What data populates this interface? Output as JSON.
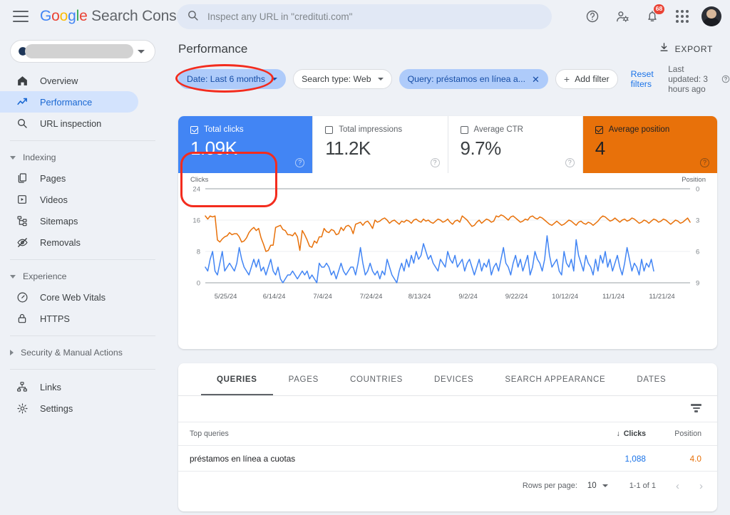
{
  "topbar": {
    "menu_icon": "hamburger-menu-icon",
    "brand": {
      "g": "G",
      "o1": "o",
      "o2": "o",
      "gg": "g",
      "l": "l",
      "e": "e",
      "suffix": " Search Console"
    },
    "search": {
      "placeholder": "Inspect any URL in \"credituti.com\"",
      "value": "",
      "icon": "search-icon"
    },
    "help_icon": "help-circle-icon",
    "account_icon": "account-settings-icon",
    "notifications_icon": "notifications-bell-icon",
    "notifications_count": "68",
    "apps_icon": "apps-grid-icon",
    "avatar": "user-avatar"
  },
  "sidebar": {
    "property_selector": {
      "label": "",
      "redacted": true
    },
    "items": [
      {
        "label": "Overview",
        "icon": "home-icon",
        "active": false
      },
      {
        "label": "Performance",
        "icon": "trending-up-icon",
        "active": true
      },
      {
        "label": "URL inspection",
        "icon": "search-icon",
        "active": false
      }
    ],
    "groups": [
      {
        "label": "Indexing",
        "expanded": true,
        "items": [
          {
            "label": "Pages",
            "icon": "pages-icon"
          },
          {
            "label": "Videos",
            "icon": "video-icon"
          },
          {
            "label": "Sitemaps",
            "icon": "sitemap-icon"
          },
          {
            "label": "Removals",
            "icon": "eye-off-icon"
          }
        ]
      },
      {
        "label": "Experience",
        "expanded": true,
        "items": [
          {
            "label": "Core Web Vitals",
            "icon": "speedometer-icon"
          },
          {
            "label": "HTTPS",
            "icon": "lock-icon"
          }
        ]
      },
      {
        "label": "Security & Manual Actions",
        "expanded": false,
        "items": []
      }
    ],
    "bottom_items": [
      {
        "label": "Links",
        "icon": "links-hierarchy-icon"
      },
      {
        "label": "Settings",
        "icon": "gear-icon"
      }
    ]
  },
  "page": {
    "title": "Performance",
    "export_label": "EXPORT",
    "export_icon": "download-icon"
  },
  "filters": {
    "chips": [
      {
        "name": "date",
        "label": "Date: Last 6 months",
        "selected": true,
        "control": "dropdown",
        "highlighted": true
      },
      {
        "name": "search-type",
        "label": "Search type: Web",
        "selected": false,
        "control": "dropdown",
        "highlighted": false
      },
      {
        "name": "query",
        "label": "Query: préstamos en línea a...",
        "selected": true,
        "control": "close",
        "highlighted": false
      }
    ],
    "add_filter_label": "Add filter",
    "reset_label": "Reset filters",
    "last_updated": "Last updated: 3 hours ago",
    "help_icon": "help-circle-icon"
  },
  "metrics": [
    {
      "name": "total-clicks",
      "label": "Total clicks",
      "value": "1.09K",
      "checked": true,
      "state": "selected-blue",
      "highlighted": true
    },
    {
      "name": "total-impressions",
      "label": "Total impressions",
      "value": "11.2K",
      "checked": false,
      "state": "off",
      "highlighted": false
    },
    {
      "name": "average-ctr",
      "label": "Average CTR",
      "value": "9.7%",
      "checked": false,
      "state": "off",
      "highlighted": false
    },
    {
      "name": "average-position",
      "label": "Average position",
      "value": "4",
      "checked": true,
      "state": "selected-orange",
      "highlighted": false
    }
  ],
  "chart_data": {
    "type": "line",
    "title": "",
    "left_axis": {
      "label": "Clicks",
      "ticks": [
        "0",
        "8",
        "16",
        "24"
      ],
      "range": [
        0,
        24
      ],
      "color": "#4285f4"
    },
    "right_axis": {
      "label": "Position",
      "ticks": [
        "0",
        "3",
        "6",
        "9"
      ],
      "range": [
        0,
        9
      ],
      "inverted": true,
      "color": "#e8710a"
    },
    "xlabel": "",
    "x_ticks": [
      "5/25/24",
      "6/14/24",
      "7/4/24",
      "7/24/24",
      "8/13/24",
      "9/2/24",
      "9/22/24",
      "10/12/24",
      "11/1/24",
      "11/21/24"
    ],
    "grid": true,
    "legend_position": "none",
    "series": [
      {
        "name": "Clicks",
        "color": "#4285f4",
        "axis": "left",
        "values": [
          4,
          3,
          6,
          8,
          3,
          2,
          5,
          8,
          3,
          4,
          5,
          4,
          3,
          5,
          9,
          6,
          4,
          3,
          2,
          4,
          6,
          4,
          6,
          3,
          4,
          2,
          4,
          6,
          3,
          2,
          4,
          1,
          0,
          1,
          2,
          2,
          3,
          2,
          1,
          2,
          3,
          2,
          3,
          1,
          2,
          1,
          0,
          5,
          4,
          4,
          5,
          4,
          2,
          3,
          1,
          3,
          5,
          3,
          2,
          3,
          4,
          4,
          2,
          5,
          9,
          5,
          2,
          3,
          5,
          3,
          2,
          3,
          1,
          3,
          2,
          6,
          4,
          2,
          1,
          0,
          3,
          5,
          3,
          6,
          4,
          7,
          5,
          8,
          6,
          7,
          10,
          8,
          6,
          7,
          5,
          4,
          3,
          6,
          5,
          4,
          8,
          6,
          5,
          7,
          4,
          5,
          6,
          3,
          5,
          6,
          4,
          2,
          4,
          6,
          3,
          5,
          4,
          6,
          2,
          4,
          5,
          3,
          6,
          9,
          5,
          4,
          2,
          5,
          7,
          4,
          6,
          3,
          5,
          7,
          2,
          4,
          8,
          6,
          5,
          3,
          6,
          12,
          7,
          4,
          5,
          6,
          3,
          2,
          8,
          5,
          4,
          6,
          3,
          11,
          7,
          5,
          3,
          7,
          5,
          4,
          2,
          6,
          3,
          7,
          5,
          8,
          4,
          6,
          3,
          5,
          7,
          4,
          2,
          5,
          9,
          6,
          3,
          5,
          4,
          2,
          6,
          3,
          5,
          4,
          6,
          3
        ]
      },
      {
        "name": "Position",
        "color": "#e8710a",
        "axis": "right",
        "values": [
          2.6,
          2.9,
          2.6,
          2.7,
          2.6,
          4.9,
          5.1,
          4.8,
          4.6,
          4.5,
          4.2,
          4.4,
          4.3,
          4.3,
          4.6,
          5.1,
          5.0,
          4.7,
          4.2,
          3.9,
          3.7,
          4.0,
          3.8,
          4.7,
          5.3,
          6.0,
          5.9,
          5.4,
          5.4,
          3.7,
          3.6,
          3.5,
          3.9,
          4.0,
          4.4,
          4.4,
          4.5,
          4.2,
          4.6,
          5.9,
          4.0,
          4.4,
          4.9,
          5.5,
          5.6,
          5.0,
          5.2,
          4.6,
          4.6,
          3.8,
          4.1,
          4.2,
          3.9,
          4.0,
          4.4,
          4.3,
          3.7,
          4.0,
          3.6,
          3.5,
          3.7,
          4.3,
          3.4,
          3.3,
          3.2,
          3.5,
          3.2,
          3.1,
          3.4,
          3.8,
          3.0,
          3.2,
          3.1,
          2.9,
          2.8,
          3.0,
          3.3,
          3.1,
          3.0,
          3.2,
          3.4,
          3.1,
          3.2,
          3.0,
          3.1,
          3.3,
          3.0,
          2.9,
          3.1,
          3.2,
          2.9,
          3.1,
          3.0,
          3.2,
          3.3,
          3.1,
          2.9,
          3.0,
          3.2,
          3.1,
          2.9,
          3.2,
          3.4,
          3.1,
          3.0,
          3.2,
          2.6,
          2.8,
          3.0,
          3.3,
          3.6,
          3.5,
          3.2,
          3.0,
          3.3,
          3.1,
          2.9,
          3.0,
          3.2,
          3.1,
          2.6,
          2.7,
          2.5,
          2.6,
          2.8,
          3.0,
          2.7,
          2.6,
          2.8,
          3.0,
          3.2,
          3.1,
          2.9,
          3.0,
          2.7,
          2.6,
          2.8,
          2.9,
          2.7,
          2.8,
          3.0,
          3.2,
          3.4,
          3.5,
          3.3,
          3.1,
          3.3,
          3.5,
          3.4,
          3.2,
          3.0,
          3.1,
          3.3,
          3.5,
          3.2,
          3.1,
          3.3,
          3.4,
          3.2,
          3.3,
          3.5,
          3.3,
          3.1,
          2.8,
          2.6,
          2.7,
          2.9,
          3.1,
          3.0,
          2.8,
          3.0,
          3.2,
          3.0,
          2.9,
          3.1,
          3.0,
          2.8,
          2.9,
          3.1,
          3.3,
          3.2,
          3.0,
          3.1,
          3.3,
          3.1,
          2.9,
          3.0,
          3.2,
          3.1,
          2.9,
          3.0,
          3.2,
          3.4,
          3.2,
          3.0,
          3.1,
          3.3,
          3.2,
          3.0,
          2.8,
          3.2
        ]
      }
    ]
  },
  "table": {
    "tabs": [
      {
        "label": "QUERIES",
        "active": true
      },
      {
        "label": "PAGES",
        "active": false
      },
      {
        "label": "COUNTRIES",
        "active": false
      },
      {
        "label": "DEVICES",
        "active": false
      },
      {
        "label": "SEARCH APPEARANCE",
        "active": false
      },
      {
        "label": "DATES",
        "active": false
      }
    ],
    "filter_icon": "filter-funnel-icon",
    "columns": {
      "query": "Top queries",
      "clicks": "Clicks",
      "position": "Position",
      "sort_icon": "sort-desc-arrow"
    },
    "rows": [
      {
        "query": "préstamos en línea a cuotas",
        "clicks": "1,088",
        "position": "4.0"
      }
    ],
    "pagination": {
      "rows_per_page_label": "Rows per page:",
      "rows_per_page_value": "10",
      "range": "1-1 of 1",
      "prev_icon": "chevron-left-icon",
      "next_icon": "chevron-right-icon"
    }
  }
}
